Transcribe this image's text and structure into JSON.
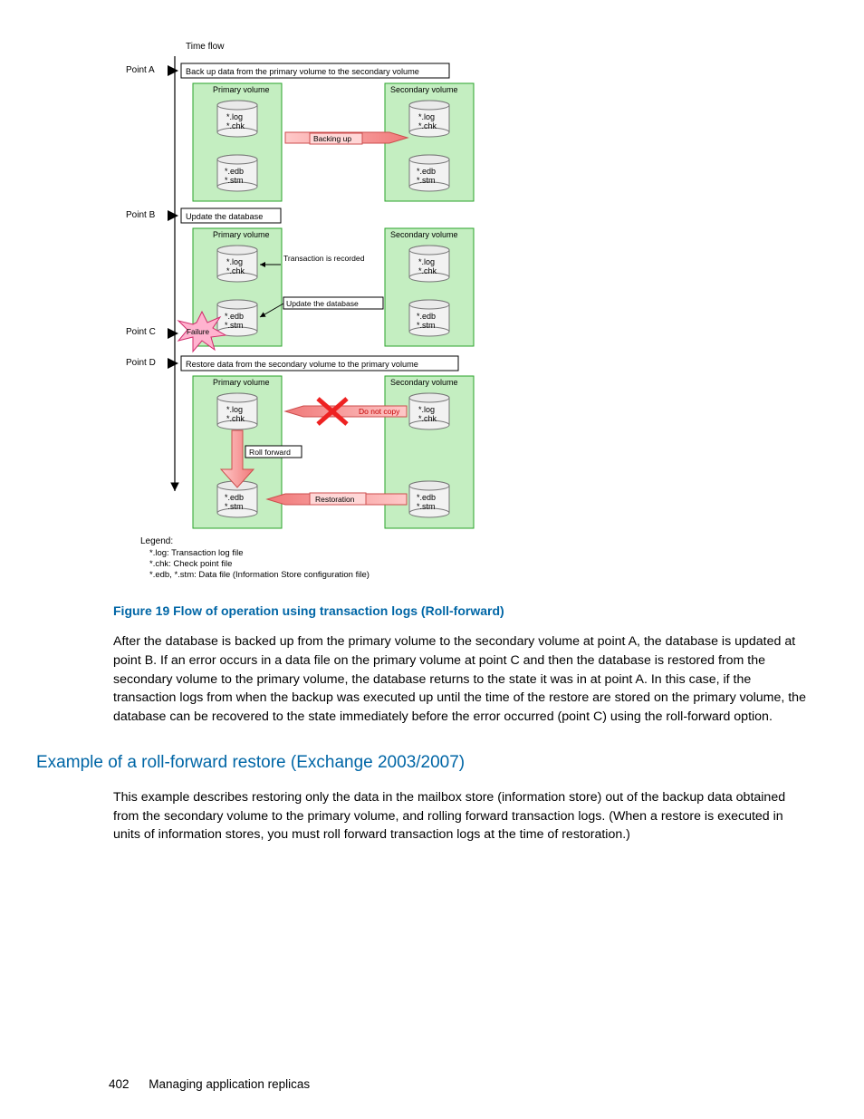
{
  "diagram": {
    "timeFlow": "Time flow",
    "pointA": "Point A",
    "pointAStep": "Back up data from the primary volume to the secondary volume",
    "pointB": "Point B",
    "pointBStep": "Update the database",
    "pointC": "Point C",
    "pointD": "Point D",
    "pointDStep": "Restore data from the secondary volume to the primary volume",
    "primaryVolume": "Primary volume",
    "secondaryVolume": "Secondary volume",
    "backingUp": "Backing up",
    "transactionRecorded": "Transaction is recorded",
    "updateDatabase": "Update the database",
    "failure": "Failure",
    "doNotCopy": "Do not copy",
    "rollForward": "Roll forward",
    "restoration": "Restoration",
    "filesLogChk": "*.log\n*.chk",
    "filesEdbStm": "*.edb\n*.stm",
    "legend": {
      "title": "Legend:",
      "log": "*.log: Transaction log file",
      "chk": "*.chk: Check point file",
      "edb": "*.edb, *.stm: Data file (Information Store configuration file)"
    }
  },
  "figureCaption": "Figure 19 Flow of operation using transaction logs (Roll-forward)",
  "para1": "After the database is backed up from the primary volume to the secondary volume at point A, the database is updated at point B. If an error occurs in a data file on the primary volume at point C and then the database is restored from the secondary volume to the primary volume, the database returns to the state it was in at point A. In this case, if the transaction logs from when the backup was executed up until the time of the restore are stored on the primary volume, the database can be recovered to the state immediately before the error occurred (point C) using the roll-forward option.",
  "sectionHeading": "Example of a roll-forward restore (Exchange 2003/2007)",
  "para2": "This example describes restoring only the data in the mailbox store (information store) out of the backup data obtained from the secondary volume to the primary volume, and rolling forward transaction logs. (When a restore is executed in units of information stores, you must roll forward transaction logs at the time of restoration.)",
  "footer": {
    "pageNumber": "402",
    "chapter": "Managing application replicas"
  }
}
